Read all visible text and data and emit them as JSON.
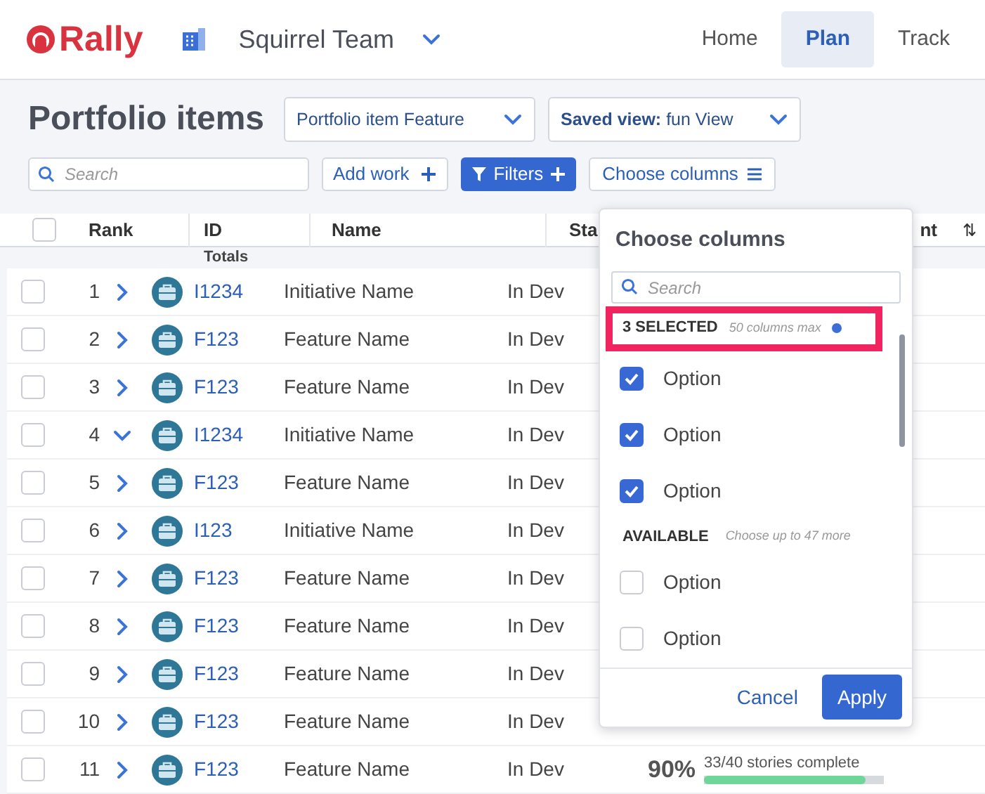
{
  "brand": "Rally",
  "team": "Squirrel Team",
  "nav": [
    {
      "label": "Home",
      "selected": false
    },
    {
      "label": "Plan",
      "selected": true
    },
    {
      "label": "Track",
      "selected": false
    }
  ],
  "page_title": "Portfolio items",
  "type_select": {
    "value": "Portfolio item Feature"
  },
  "saved_view": {
    "label": "Saved view:",
    "value": "fun View"
  },
  "search": {
    "placeholder": "Search"
  },
  "buttons": {
    "add_work": "Add work",
    "filters": "Filters",
    "choose_columns": "Choose columns"
  },
  "table": {
    "select_all": {
      "checked": false
    },
    "columns": [
      "Rank",
      "ID",
      "Name",
      "Sta",
      "nt"
    ],
    "sort_icon": "⇅",
    "totals": "Totals",
    "rows": [
      {
        "checked": false,
        "rank": "1",
        "expanded": false,
        "id": "I1234",
        "name": "Initiative Name",
        "state": "In Dev"
      },
      {
        "checked": false,
        "rank": "2",
        "expanded": false,
        "id": "F123",
        "name": "Feature Name",
        "state": "In Dev"
      },
      {
        "checked": false,
        "rank": "3",
        "expanded": false,
        "id": "F123",
        "name": "Feature Name",
        "state": "In Dev"
      },
      {
        "checked": false,
        "rank": "4",
        "expanded": true,
        "id": "I1234",
        "name": "Initiative Name",
        "state": "In Dev"
      },
      {
        "checked": false,
        "rank": "5",
        "expanded": false,
        "id": "F123",
        "name": "Feature Name",
        "state": "In Dev"
      },
      {
        "checked": false,
        "rank": "6",
        "expanded": false,
        "id": "I123",
        "name": "Initiative Name",
        "state": "In Dev"
      },
      {
        "checked": false,
        "rank": "7",
        "expanded": false,
        "id": "F123",
        "name": "Feature Name",
        "state": "In Dev"
      },
      {
        "checked": false,
        "rank": "8",
        "expanded": false,
        "id": "F123",
        "name": "Feature Name",
        "state": "In Dev"
      },
      {
        "checked": false,
        "rank": "9",
        "expanded": false,
        "id": "F123",
        "name": "Feature Name",
        "state": "In Dev"
      },
      {
        "checked": false,
        "rank": "10",
        "expanded": false,
        "id": "F123",
        "name": "Feature Name",
        "state": "In Dev"
      },
      {
        "checked": false,
        "rank": "11",
        "expanded": false,
        "id": "F123",
        "name": "Feature Name",
        "state": "In Dev",
        "progress": {
          "percent": "90%",
          "label": "33/40 stories complete",
          "level": 0.9
        }
      }
    ]
  },
  "column_picker": {
    "title": "Choose columns",
    "search": {
      "placeholder": "Search"
    },
    "selected_heading": "3 SELECTED",
    "selected_note": "50 columns max",
    "selected_options": [
      {
        "label": "Option",
        "checked": true
      },
      {
        "label": "Option",
        "checked": true
      },
      {
        "label": "Option",
        "checked": true
      }
    ],
    "available_heading": "AVAILABLE",
    "available_note": "Choose up to 47 more",
    "available_options": [
      {
        "label": "Option",
        "checked": false
      },
      {
        "label": "Option",
        "checked": false
      }
    ],
    "cancel": "Cancel",
    "apply": "Apply"
  }
}
